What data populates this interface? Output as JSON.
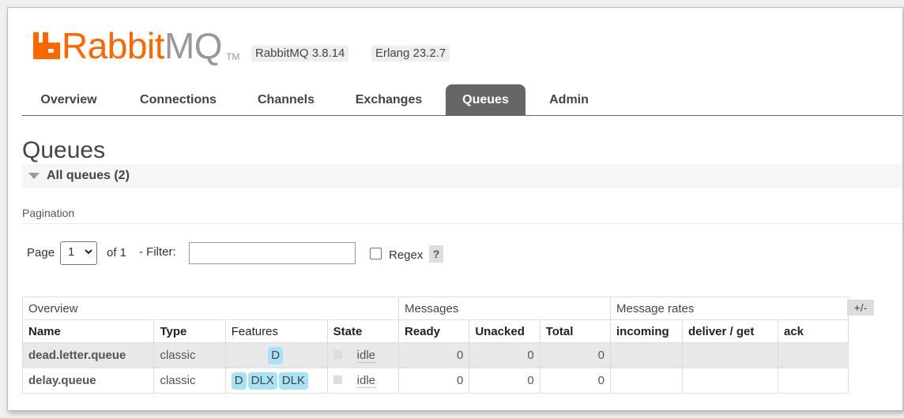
{
  "header": {
    "logo_word_orange": "Rabbit",
    "logo_word_grey": "MQ",
    "logo_tm": "TM",
    "version_rabbitmq": "RabbitMQ 3.8.14",
    "version_erlang": "Erlang 23.2.7"
  },
  "colors": {
    "brand": "#ff6600",
    "active_tab": "#666666",
    "feature_badge": "#a8e3f5"
  },
  "tabs": [
    {
      "label": "Overview",
      "active": false
    },
    {
      "label": "Connections",
      "active": false
    },
    {
      "label": "Channels",
      "active": false
    },
    {
      "label": "Exchanges",
      "active": false
    },
    {
      "label": "Queues",
      "active": true
    },
    {
      "label": "Admin",
      "active": false
    }
  ],
  "page_title": "Queues",
  "section_title": "All queues (2)",
  "pagination": {
    "label": "Pagination",
    "page_label": "Page",
    "page_value": "1",
    "of_label": "of 1",
    "filter_label": "- Filter:",
    "filter_value": "",
    "regex_label": "Regex",
    "regex_checked": false,
    "help_label": "?"
  },
  "table": {
    "groups": [
      "Overview",
      "Messages",
      "Message rates"
    ],
    "columns_toggle": "+/-",
    "headers": [
      "Name",
      "Type",
      "Features",
      "State",
      "Ready",
      "Unacked",
      "Total",
      "incoming",
      "deliver / get",
      "ack"
    ],
    "rows": [
      {
        "name": "dead.letter.queue",
        "type": "classic",
        "features": [
          "D"
        ],
        "state": "idle",
        "ready": "0",
        "unacked": "0",
        "total": "0",
        "incoming": "",
        "deliver_get": "",
        "ack": ""
      },
      {
        "name": "delay.queue",
        "type": "classic",
        "features": [
          "D",
          "DLX",
          "DLK"
        ],
        "state": "idle",
        "ready": "0",
        "unacked": "0",
        "total": "0",
        "incoming": "",
        "deliver_get": "",
        "ack": ""
      }
    ]
  }
}
